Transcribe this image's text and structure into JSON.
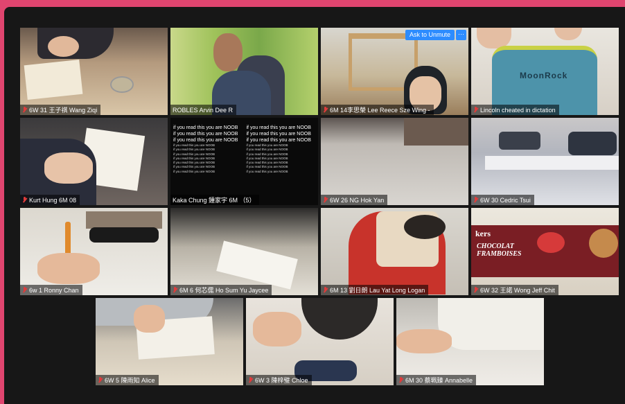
{
  "meeting": {
    "tiles": [
      {
        "name": "6W 31 王子祺 Wang Ziqi"
      },
      {
        "name": "ROBLES Arvin Dee R"
      },
      {
        "name": "6M 14李思榮 Lee Reece Sze Wing -",
        "unmute_label": "Ask to Unmute",
        "more_label": "···"
      },
      {
        "name": "Lincoln cheated in dictation",
        "sticker": "MoonRock"
      },
      {
        "name": "Kurt Hung 6M 08"
      },
      {
        "name": "Kaka Chung 鍾家宇 6M （5）",
        "chat_line": "if you read this you are NOOB"
      },
      {
        "name": "6W 26 NG Hok Yan"
      },
      {
        "name": "6W 30 Cedric Tsui"
      },
      {
        "name": "6w 1 Ronny Chan"
      },
      {
        "name": "6M 6 何芯儒 Ho Sum Yu Jaycee"
      },
      {
        "name": "6M 13 劉日朗 Lau Yat Long Logan"
      },
      {
        "name": "6W 32 王諾 Wong Jeff Chit",
        "box_brand": "kers",
        "box_label_1": "CHOCOLAT",
        "box_label_2": "FRAMBOISES"
      },
      {
        "name": "6W 5 陳雨知 Alice"
      },
      {
        "name": "6W 3 陳梓璧 Chloe"
      },
      {
        "name": "6M 30 蔡珮臻 Annabelle"
      }
    ]
  },
  "colors": {
    "background": "#e0456f",
    "gallery": "#171717",
    "active_speaker": "#d9d24c",
    "button": "#2d8cff",
    "muted": "#e03b3b"
  }
}
